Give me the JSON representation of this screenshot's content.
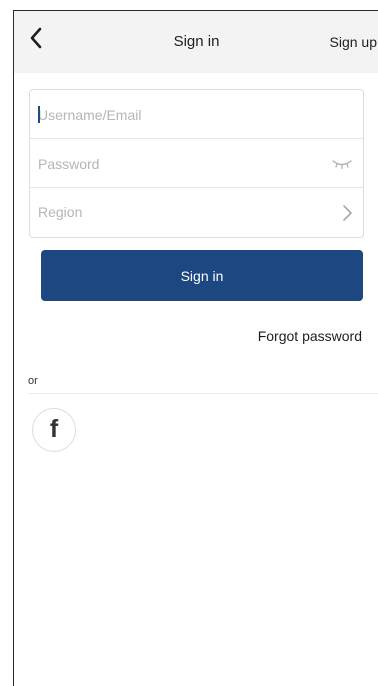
{
  "header": {
    "title": "Sign in",
    "signup_label": "Sign up",
    "back_icon": "chevron-left-icon"
  },
  "form": {
    "username_placeholder": "Username/Email",
    "password_placeholder": "Password",
    "password_toggle_icon": "eye-closed-icon",
    "region_label": "Region",
    "region_icon": "chevron-right-icon"
  },
  "actions": {
    "signin_label": "Sign in",
    "forgot_label": "Forgot password"
  },
  "social": {
    "or_label": "or",
    "facebook_glyph": "f",
    "facebook_icon": "facebook-icon"
  },
  "colors": {
    "primary": "#1c4780",
    "header_bg": "#f3f3f3",
    "placeholder": "#b5b5b5"
  }
}
